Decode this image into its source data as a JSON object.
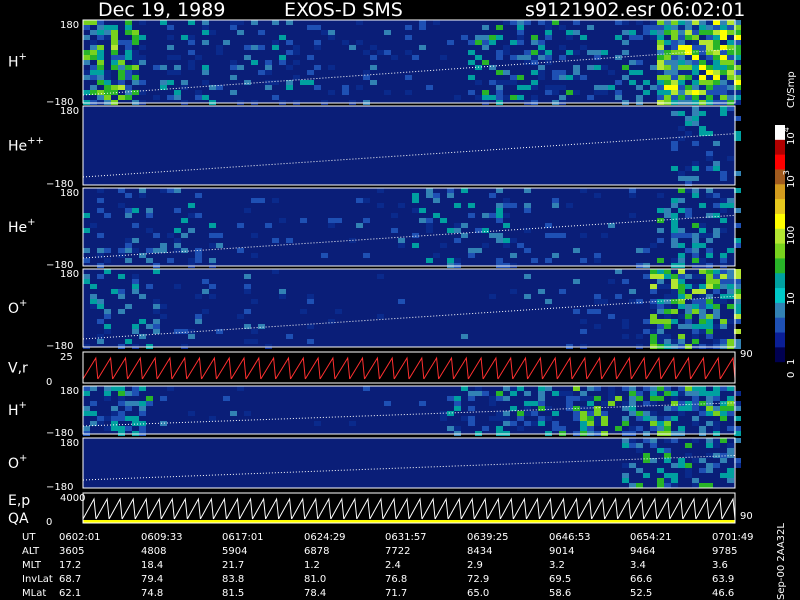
{
  "header": {
    "date": "Dec 19, 1989",
    "instrument": "EXOS-D SMS",
    "file": "s9121902.esr",
    "time": "06:02:01"
  },
  "colorbar": {
    "unit": "Ct/Smp",
    "ticks": [
      {
        "label": "10",
        "sup": "4"
      },
      {
        "label": "10",
        "sup": "3"
      },
      {
        "label": "100",
        "sup": ""
      },
      {
        "label": "10",
        "sup": ""
      },
      {
        "label": "1",
        "sup": ""
      },
      {
        "label": "0",
        "sup": ""
      }
    ],
    "colors": [
      "#ffffff",
      "#b00000",
      "#ff0000",
      "#a05a1e",
      "#d29b1e",
      "#e6c81e",
      "#ffff00",
      "#b4e632",
      "#78d21e",
      "#28b428",
      "#00a0a0",
      "#00c8c8",
      "#3282b4",
      "#1e50b4",
      "#0a1e96",
      "#000050",
      "#000000"
    ]
  },
  "footer": {
    "side_label": "Sep-00  2AA32L",
    "table": {
      "rows": [
        {
          "name": "UT",
          "values": [
            "0602:01",
            "0609:33",
            "0617:01",
            "0624:29",
            "0631:57",
            "0639:25",
            "0646:53",
            "0654:21",
            "0701:49"
          ]
        },
        {
          "name": "ALT",
          "values": [
            "3605",
            "4808",
            "5904",
            "6878",
            "7722",
            "8434",
            "9014",
            "9464",
            "9785"
          ]
        },
        {
          "name": "MLT",
          "values": [
            "17.2",
            "18.4",
            "21.7",
            "1.2",
            "2.4",
            "2.9",
            "3.2",
            "3.4",
            "3.6"
          ]
        },
        {
          "name": "InvLat",
          "values": [
            "68.7",
            "79.4",
            "83.8",
            "81.0",
            "76.8",
            "72.9",
            "69.5",
            "66.6",
            "63.9"
          ]
        },
        {
          "name": "MLat",
          "values": [
            "62.1",
            "74.8",
            "81.5",
            "78.4",
            "71.7",
            "65.0",
            "58.6",
            "52.5",
            "46.6"
          ]
        }
      ]
    }
  },
  "chart_data": {
    "type": "heatmap",
    "title": "Dec 19, 1989   EXOS-D SMS",
    "x": [
      "0602:01",
      "0609:33",
      "0617:01",
      "0624:29",
      "0631:57",
      "0639:25",
      "0646:53",
      "0654:21",
      "0701:49"
    ],
    "panels": [
      {
        "label": "H",
        "sup": "+",
        "ymax": "180",
        "ymin": "−180",
        "activity": [
          [
            0.0,
            0.08,
            0.7
          ],
          [
            0.08,
            0.2,
            0.3
          ],
          [
            0.2,
            0.35,
            0.25
          ],
          [
            0.35,
            0.5,
            0.1
          ],
          [
            0.5,
            0.58,
            0.05
          ],
          [
            0.58,
            0.75,
            0.45
          ],
          [
            0.75,
            0.87,
            0.35
          ],
          [
            0.87,
            1.0,
            0.95
          ]
        ]
      },
      {
        "label": "He",
        "sup": "++",
        "ymax": "180",
        "ymin": "−180",
        "activity": [
          [
            0.0,
            0.9,
            0.0
          ],
          [
            0.9,
            1.0,
            0.3
          ]
        ]
      },
      {
        "label": "He",
        "sup": "+",
        "ymax": "180",
        "ymin": "−180",
        "activity": [
          [
            0.0,
            0.2,
            0.25
          ],
          [
            0.2,
            0.5,
            0.05
          ],
          [
            0.5,
            0.68,
            0.3
          ],
          [
            0.68,
            0.87,
            0.1
          ],
          [
            0.87,
            1.0,
            0.35
          ]
        ]
      },
      {
        "label": "O",
        "sup": "+",
        "ymax": "180",
        "ymin": "−180",
        "activity": [
          [
            0.0,
            0.12,
            0.3
          ],
          [
            0.12,
            0.35,
            0.1
          ],
          [
            0.35,
            0.65,
            0.03
          ],
          [
            0.65,
            0.86,
            0.12
          ],
          [
            0.86,
            1.0,
            0.75
          ]
        ]
      },
      {
        "label": "V,r",
        "sup": "",
        "ymax": "25",
        "ymin": "0",
        "right_tick": "90",
        "type": "line"
      },
      {
        "label": "H",
        "sup": "+",
        "ymax": "180",
        "ymin": "−180",
        "activity": [
          [
            0.0,
            0.1,
            0.45
          ],
          [
            0.1,
            0.55,
            0.03
          ],
          [
            0.55,
            0.75,
            0.35
          ],
          [
            0.75,
            1.0,
            0.6
          ]
        ]
      },
      {
        "label": "O",
        "sup": "+",
        "ymax": "180",
        "ymin": "−180",
        "activity": [
          [
            0.0,
            0.82,
            0.0
          ],
          [
            0.82,
            1.0,
            0.45
          ]
        ]
      },
      {
        "label": "E,p",
        "sup": "",
        "label2": "QA",
        "ymax": "4000",
        "ymin": "0",
        "right_tick": "90",
        "type": "line"
      }
    ]
  }
}
